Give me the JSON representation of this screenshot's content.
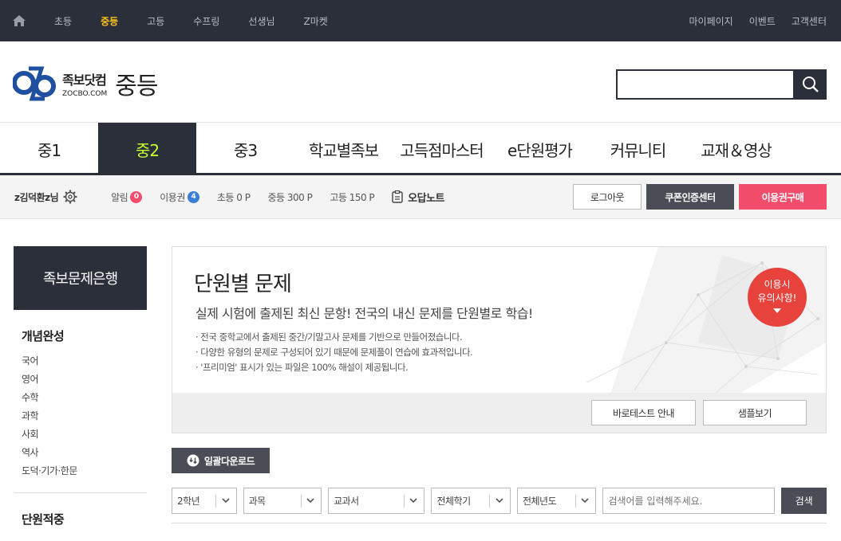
{
  "topbar": {
    "links": [
      "초등",
      "중등",
      "고등",
      "수프링",
      "선생님",
      "Z마켓"
    ],
    "active": "중등",
    "right_links": [
      "마이페이지",
      "이벤트",
      "고객센터"
    ]
  },
  "header": {
    "logo_ko": "족보닷컴",
    "logo_en": "ZOCBO.COM",
    "level": "중등",
    "search_placeholder": ""
  },
  "mainnav": [
    "중1",
    "중2",
    "중3",
    "학교별족보",
    "고득점마스터",
    "e단원평가",
    "커뮤니티",
    "교재＆영상"
  ],
  "mainnav_active": "중2",
  "userbar": {
    "user": "z김덕환z님",
    "alarm_label": "알림",
    "alarm_count": "0",
    "ticket_label": "이용권",
    "ticket_count": "4",
    "elem_points": "초등 0 P",
    "mid_points": "중등 300 P",
    "high_points": "고등 150 P",
    "note": "오답노트",
    "logout": "로그아웃",
    "coupon": "쿠폰인증센터",
    "buy": "이용권구매"
  },
  "sidebar": {
    "title": "족보문제은행",
    "section1": "개념완성",
    "items": [
      "국어",
      "영어",
      "수학",
      "과학",
      "사회",
      "역사",
      "도덕·기가·한문"
    ],
    "section2": "단원적중"
  },
  "banner": {
    "title": "단원별 문제",
    "subtitle": "실제 시험에 출제된 최신 문항! 전국의 내신 문제를 단원별로 학습!",
    "bullets": [
      "· 전국 중학교에서 출제된 중간/기말고사 문제를 기반으로 만들어졌습니다.",
      "· 다양한 유형의 문제로 구성되어 있기 때문에 문제풀이 연습에 효과적입니다.",
      "· '프리미엄' 표시가 있는 파일은 100% 해설이 제공됩니다."
    ],
    "notice_line1": "이용시",
    "notice_line2": "유의사항!",
    "btn_guide": "바로테스트 안내",
    "btn_sample": "샘플보기"
  },
  "bulk_download": "일괄다운로드",
  "filters": {
    "grade": "2학년",
    "subject": "과목",
    "textbook": "교과서",
    "semester": "전체학기",
    "year": "전체년도",
    "search_placeholder": "검색어를 입력해주세요.",
    "search_button": "검색"
  },
  "colors": {
    "dark": "#2b2f3a",
    "accent_yellow": "#ffc21a",
    "accent_green": "#c6ff2e",
    "pink": "#f24d6b",
    "red": "#e8423c"
  }
}
